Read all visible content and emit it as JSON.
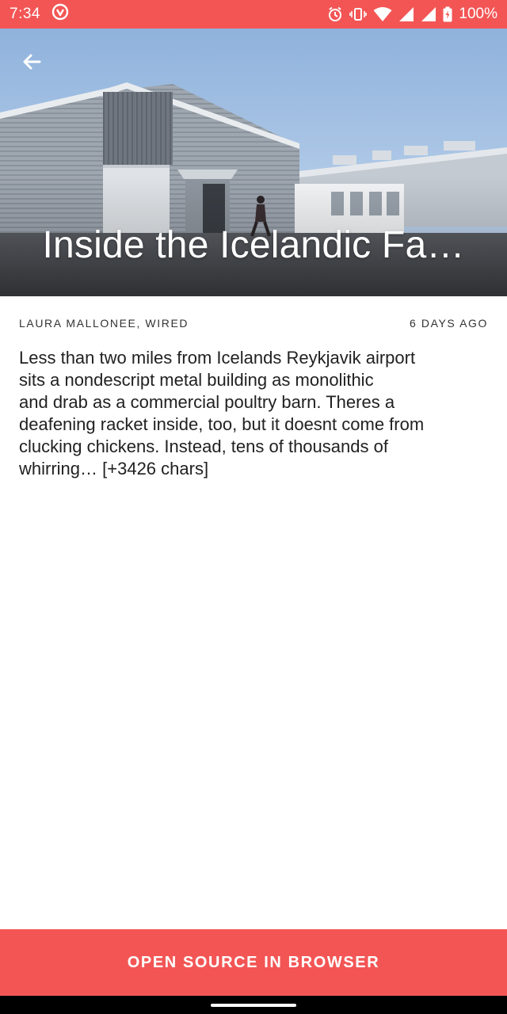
{
  "status_bar": {
    "time": "7:34",
    "battery": "100%",
    "icons": [
      "app-notification-icon",
      "alarm-icon",
      "vibrate-icon",
      "wifi-icon",
      "signal-icon",
      "signal-icon-2",
      "battery-icon"
    ]
  },
  "hero": {
    "title": "Inside the Icelandic Fa…",
    "back_icon": "arrow-left-icon"
  },
  "article": {
    "author": "LAURA MALLONEE, WIRED",
    "time_ago": "6 DAYS AGO",
    "body_lines": [
      "Less than two miles from Icelands Reykjavik airport",
      "sits a nondescript metal building as monolithic",
      "and drab as a commercial poultry barn. Theres a",
      "deafening racket inside, too, but it doesnt come from",
      "clucking chickens. Instead, tens of thousands of",
      "whirring… [+3426 chars]"
    ]
  },
  "cta": {
    "label": "OPEN SOURCE IN BROWSER"
  },
  "colors": {
    "accent": "#f35555",
    "text": "#212121"
  }
}
